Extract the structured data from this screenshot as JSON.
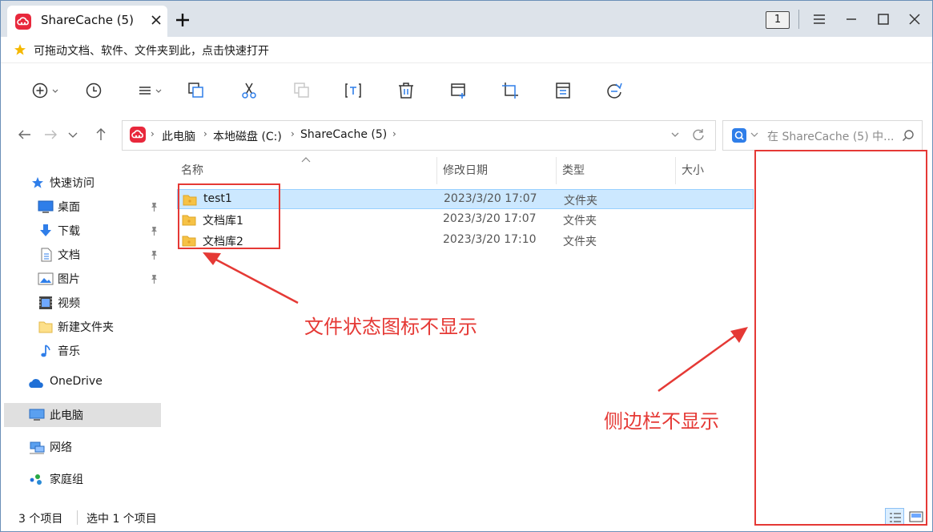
{
  "window": {
    "tab_title": "ShareCache (5)",
    "page_indicator": "1"
  },
  "favorites_bar": {
    "hint": "可拖动文档、软件、文件夹到此，点击快速打开"
  },
  "toolbar": {
    "icons": [
      "add-circle-icon",
      "history-clock-icon",
      "view-list-icon",
      "copy-icon",
      "cut-scissors-icon",
      "paste-icon",
      "rename-icon",
      "delete-trash-icon",
      "new-window-icon",
      "crop-icon",
      "properties-icon",
      "refresh-browser-icon"
    ]
  },
  "address": {
    "breadcrumbs": [
      "此电脑",
      "本地磁盘 (C:)",
      "ShareCache (5)"
    ],
    "search_placeholder": "在 ShareCache (5) 中..."
  },
  "nav": {
    "quick_access_label": "快速访问",
    "items": [
      {
        "label": "桌面",
        "icon": "desktop-icon",
        "pinned": true
      },
      {
        "label": "下载",
        "icon": "download-arrow-icon",
        "pinned": true
      },
      {
        "label": "文档",
        "icon": "document-icon",
        "pinned": true
      },
      {
        "label": "图片",
        "icon": "picture-icon",
        "pinned": true
      },
      {
        "label": "视频",
        "icon": "video-icon",
        "pinned": false
      },
      {
        "label": "新建文件夹",
        "icon": "folder-icon",
        "pinned": false
      },
      {
        "label": "音乐",
        "icon": "music-note-icon",
        "pinned": false
      }
    ],
    "onedrive_label": "OneDrive",
    "this_pc_label": "此电脑",
    "network_label": "网络",
    "homegroup_label": "家庭组"
  },
  "file_list": {
    "columns": [
      "名称",
      "修改日期",
      "类型",
      "大小"
    ],
    "rows": [
      {
        "name": "test1",
        "modified": "2023/3/20 17:07",
        "type": "文件夹",
        "selected": true
      },
      {
        "name": "文档库1",
        "modified": "2023/3/20 17:07",
        "type": "文件夹",
        "selected": false
      },
      {
        "name": "文档库2",
        "modified": "2023/3/20 17:10",
        "type": "文件夹",
        "selected": false
      }
    ]
  },
  "status": {
    "item_count": "3 个项目",
    "selected_count": "选中 1 个项目"
  },
  "annotations": {
    "icon_note": "文件状态图标不显示",
    "sidebar_note": "侧边栏不显示"
  },
  "colors": {
    "accent_red": "#e53935",
    "app_red": "#e8283c",
    "selection_blue": "#cce8ff",
    "folder_yellow": "#f6c245"
  }
}
